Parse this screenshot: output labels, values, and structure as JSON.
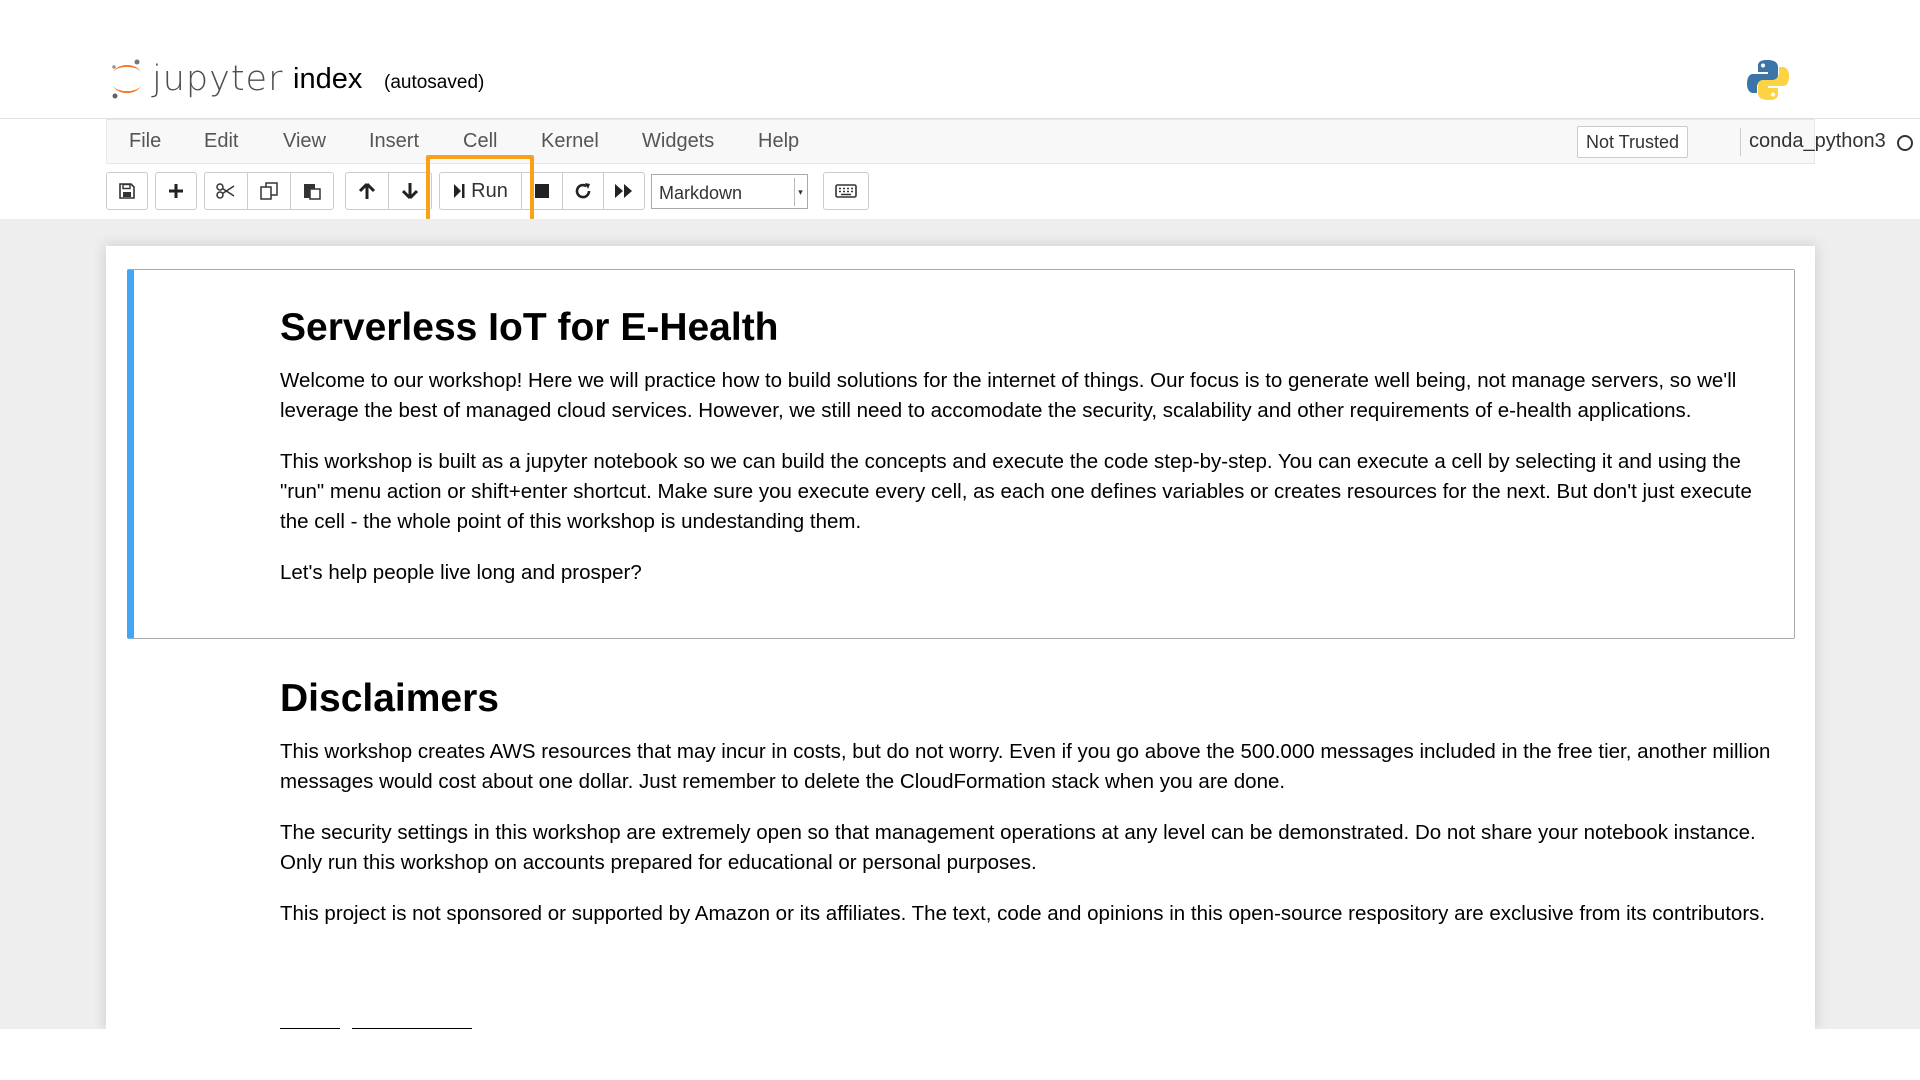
{
  "header": {
    "logo_text": "jupyter",
    "notebook_name": "index",
    "autosave_status": "(autosaved)"
  },
  "menubar": {
    "items": [
      "File",
      "Edit",
      "View",
      "Insert",
      "Cell",
      "Kernel",
      "Widgets",
      "Help"
    ],
    "trust_status": "Not Trusted",
    "kernel_name": "conda_python3"
  },
  "toolbar": {
    "run_label": "Run",
    "cell_type": "Markdown"
  },
  "cells": {
    "intro": {
      "heading": "Serverless IoT for E-Health",
      "paragraphs": [
        "Welcome to our workshop! Here we will practice how to build solutions for the internet of things. Our focus is to generate well being, not manage servers, so we'll leverage the best of managed cloud services. However, we still need to accomodate the security, scalability and other requirements of e-health applications.",
        "This workshop is built as a jupyter notebook so we can build the concepts and execute the code step-by-step. You can execute a cell by selecting it and using the \"run\" menu action or shift+enter shortcut. Make sure you execute every cell, as each one defines variables or creates resources for the next. But don't just execute the cell - the whole point of this workshop is undestanding them.",
        "Let's help people live long and prosper?"
      ]
    },
    "disclaimers": {
      "heading": "Disclaimers",
      "paragraphs": [
        "This workshop creates AWS resources that may incur in costs, but do not worry. Even if you go above the 500.000 messages included in the free tier, another million messages would cost about one dollar. Just remember to delete the CloudFormation stack when you are done.",
        "The security settings in this workshop are extremely open so that management operations at any level can be demonstrated. Do not share your notebook instance. Only run this workshop on accounts prepared for educational or personal purposes.",
        "This project is not sponsored or supported by Amazon or its affiliates. The text, code and opinions in this open-source respository are exclusive from its contributors."
      ]
    }
  },
  "colors": {
    "selected_cell_border": "#42a5f5",
    "highlight": "#f9a11b",
    "jupyter_orange": "#f37726"
  },
  "icons": [
    "save-icon",
    "plus-icon",
    "cut-icon",
    "copy-icon",
    "paste-icon",
    "arrow-up-icon",
    "arrow-down-icon",
    "step-forward-icon",
    "stop-icon",
    "restart-icon",
    "fast-forward-icon",
    "keyboard-icon",
    "python-logo-icon"
  ]
}
